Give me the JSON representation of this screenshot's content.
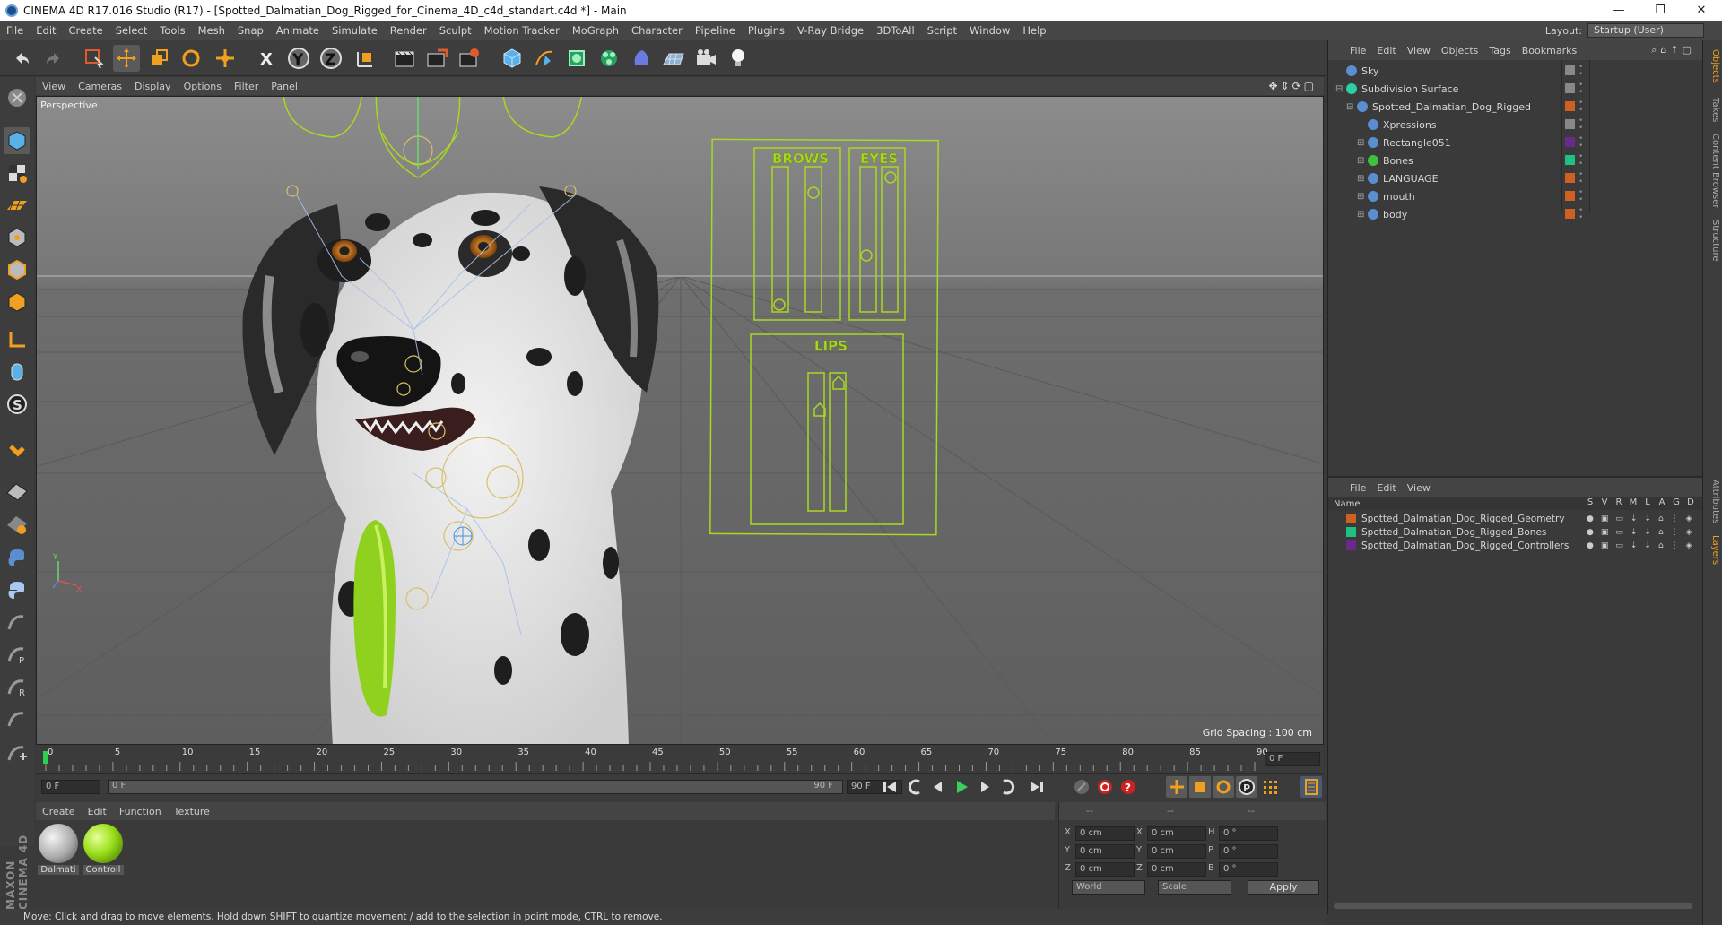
{
  "window": {
    "title": "CINEMA 4D R17.016 Studio (R17) - [Spotted_Dalmatian_Dog_Rigged_for_Cinema_4D_c4d_standart.c4d *] - Main",
    "buttons": [
      "—",
      "❐",
      "✕"
    ]
  },
  "menu": [
    "File",
    "Edit",
    "Create",
    "Select",
    "Tools",
    "Mesh",
    "Snap",
    "Animate",
    "Simulate",
    "Render",
    "Sculpt",
    "Motion Tracker",
    "MoGraph",
    "Character",
    "Pipeline",
    "Plugins",
    "V-Ray Bridge",
    "3DToAll",
    "Script",
    "Window",
    "Help"
  ],
  "layout": {
    "label": "Layout:",
    "value": "Startup (User)"
  },
  "viewport": {
    "menu": [
      "View",
      "Cameras",
      "Display",
      "Options",
      "Filter",
      "Panel"
    ],
    "label": "Perspective",
    "grid_spacing": "Grid Spacing : 100 cm",
    "panels": {
      "brows": "BROWS",
      "eyes": "EYES",
      "lips": "LIPS"
    }
  },
  "timeline": {
    "ticks": [
      "0",
      "5",
      "10",
      "15",
      "20",
      "25",
      "30",
      "35",
      "40",
      "45",
      "50",
      "55",
      "60",
      "65",
      "70",
      "75",
      "80",
      "85",
      "90"
    ],
    "frame_field": "0 F",
    "start": "0 F",
    "range_start": "0 F",
    "range_end": "90 F",
    "end": "90 F"
  },
  "materials": {
    "menu": [
      "Create",
      "Edit",
      "Function",
      "Texture"
    ],
    "items": [
      {
        "label": "Dalmati",
        "color": "#9a9a9a"
      },
      {
        "label": "Controll",
        "color": "#9adf1a"
      }
    ]
  },
  "coords": {
    "header": [
      "--",
      "--",
      "--"
    ],
    "rows": [
      {
        "a": "X",
        "av": "0 cm",
        "b": "X",
        "bv": "0 cm",
        "c": "H",
        "cv": "0 °"
      },
      {
        "a": "Y",
        "av": "0 cm",
        "b": "Y",
        "bv": "0 cm",
        "c": "P",
        "cv": "0 °"
      },
      {
        "a": "Z",
        "av": "0 cm",
        "b": "Z",
        "bv": "0 cm",
        "c": "B",
        "cv": "0 °"
      }
    ],
    "mode": "World",
    "scale": "Scale",
    "apply": "Apply"
  },
  "status": "Move: Click and drag to move elements. Hold down SHIFT to quantize movement / add to the selection in point mode, CTRL to remove.",
  "brand": "MAXON CINEMA 4D",
  "objects": {
    "menu": [
      "File",
      "Edit",
      "View",
      "Objects",
      "Tags",
      "Bookmarks"
    ],
    "rows": [
      {
        "name": "Sky",
        "indent": 0,
        "color": "#888888"
      },
      {
        "name": "Subdivision Surface",
        "indent": 0,
        "color": "#888888"
      },
      {
        "name": "Spotted_Dalmatian_Dog_Rigged",
        "indent": 1,
        "color": "#d06020"
      },
      {
        "name": "Xpressions",
        "indent": 2,
        "color": "#888888"
      },
      {
        "name": "Rectangle051",
        "indent": 2,
        "color": "#6a2a8a"
      },
      {
        "name": "Bones",
        "indent": 2,
        "color": "#20c080"
      },
      {
        "name": "LANGUAGE",
        "indent": 2,
        "color": "#d06020"
      },
      {
        "name": "mouth",
        "indent": 2,
        "color": "#d06020"
      },
      {
        "name": "body",
        "indent": 2,
        "color": "#d06020"
      }
    ]
  },
  "layers": {
    "menu": [
      "File",
      "Edit",
      "View"
    ],
    "header": {
      "name": "Name",
      "cols": [
        "S",
        "V",
        "R",
        "M",
        "L",
        "A",
        "G",
        "D"
      ]
    },
    "rows": [
      {
        "name": "Spotted_Dalmatian_Dog_Rigged_Geometry",
        "color": "#d06020"
      },
      {
        "name": "Spotted_Dalmatian_Dog_Rigged_Bones",
        "color": "#20c080"
      },
      {
        "name": "Spotted_Dalmatian_Dog_Rigged_Controllers",
        "color": "#6a2a8a"
      }
    ]
  },
  "right_tabs": [
    "Objects",
    "Takes",
    "Content Browser",
    "Structure",
    "Attributes",
    "Layers"
  ]
}
